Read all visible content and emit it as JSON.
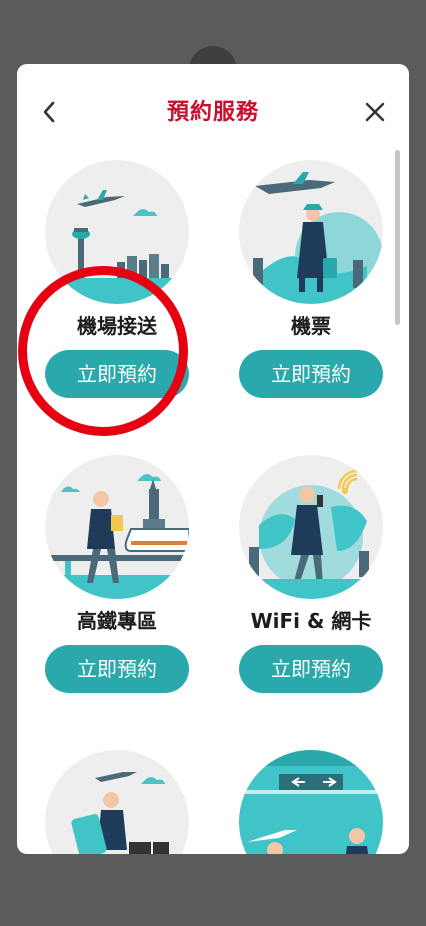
{
  "header": {
    "title": "預約服務"
  },
  "cards": [
    {
      "label": "機場接送",
      "button": "立即預約"
    },
    {
      "label": "機票",
      "button": "立即預約"
    },
    {
      "label": "高鐵專區",
      "button": "立即預約"
    },
    {
      "label": "WiFi & 網卡",
      "button": "立即預約"
    },
    {
      "label": "",
      "button": ""
    },
    {
      "label": "",
      "button": ""
    }
  ],
  "icons": {
    "back": "chevron-left-icon",
    "close": "close-icon"
  },
  "colors": {
    "accent": "#2aa9ad",
    "title": "#c8102e",
    "highlight_ring": "#e60012"
  }
}
